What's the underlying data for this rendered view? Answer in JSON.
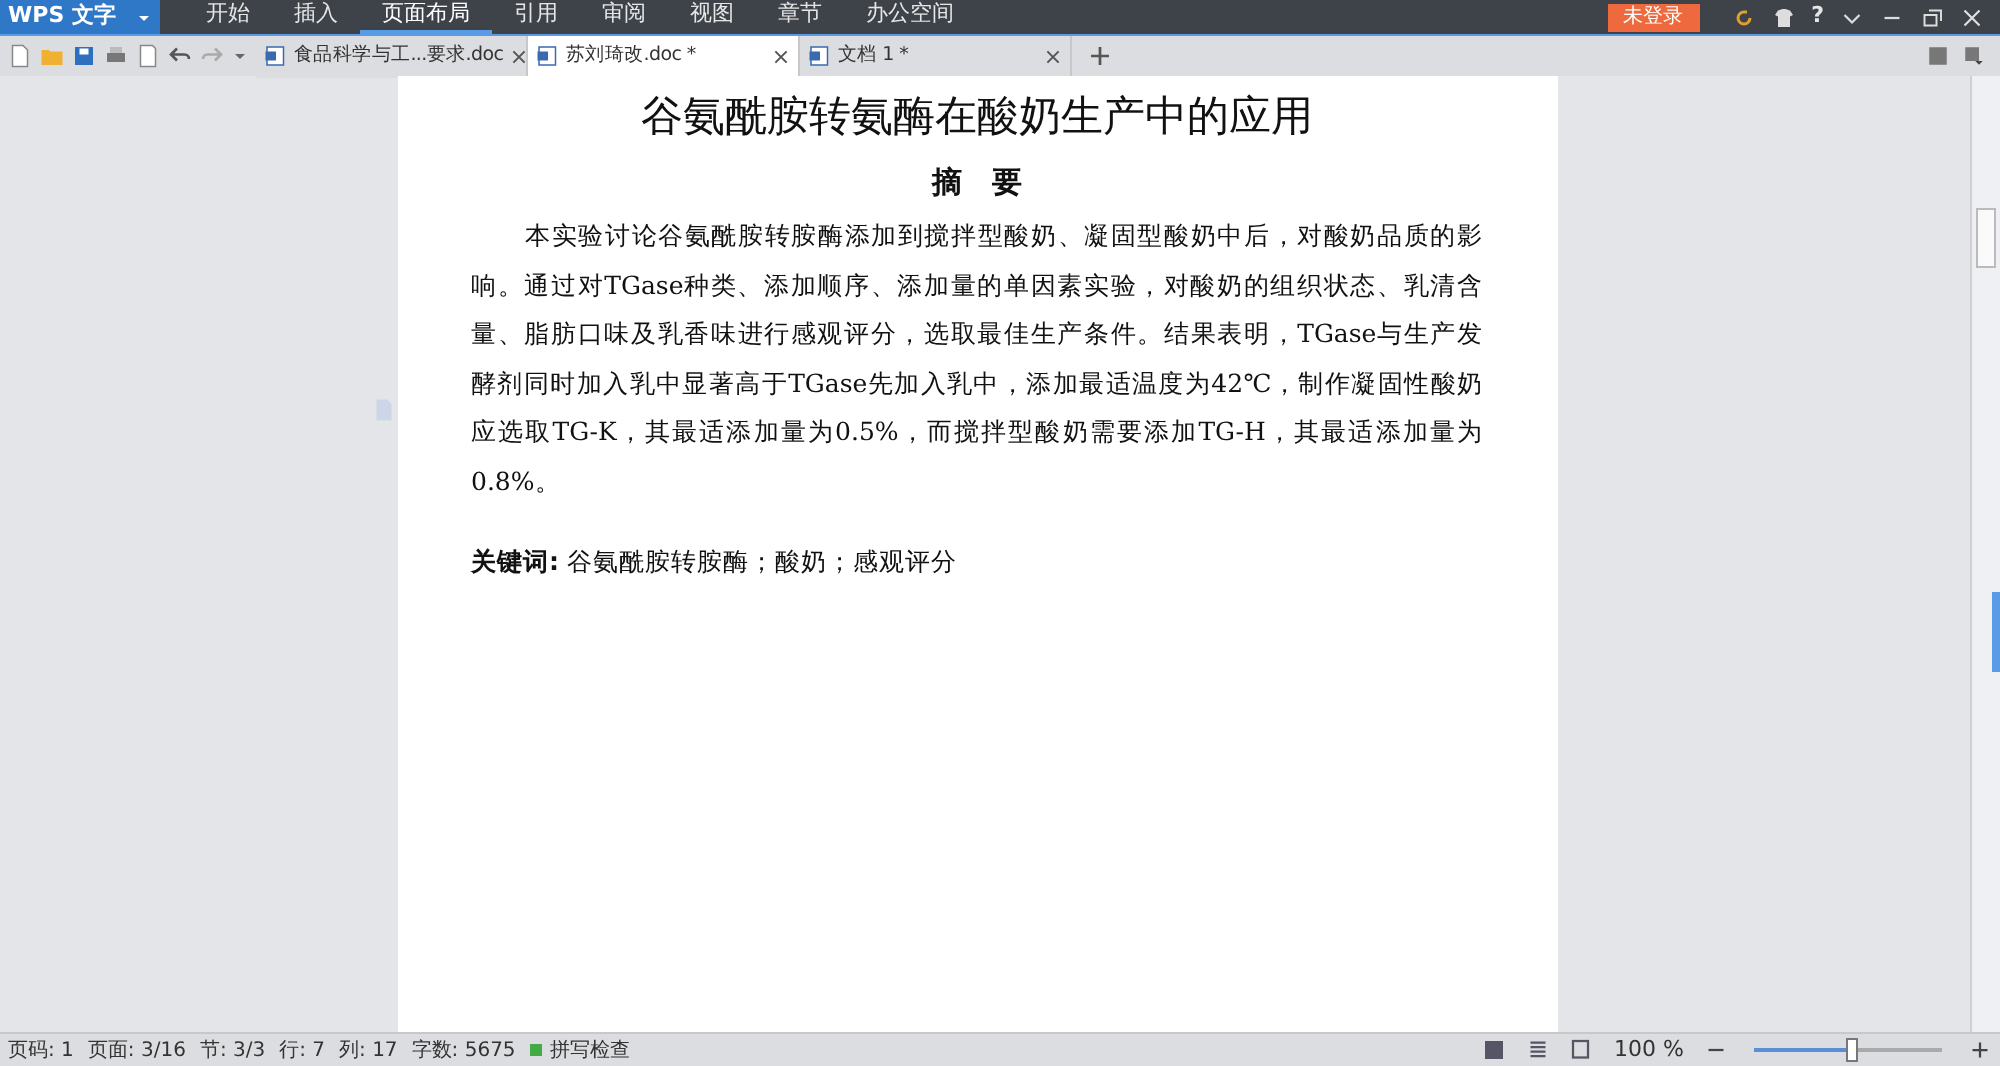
{
  "app_menu": {
    "label": "WPS 文字"
  },
  "menu": [
    {
      "label": "开始",
      "selected": false
    },
    {
      "label": "插入",
      "selected": false
    },
    {
      "label": "页面布局",
      "selected": true
    },
    {
      "label": "引用",
      "selected": false
    },
    {
      "label": "审阅",
      "selected": false
    },
    {
      "label": "视图",
      "selected": false
    },
    {
      "label": "章节",
      "selected": false
    },
    {
      "label": "办公空间",
      "selected": false
    }
  ],
  "login_button": "未登录",
  "help_label": "?",
  "tabs": [
    {
      "label": "食品科学与工...要求.doc",
      "selected": false
    },
    {
      "label": "苏刘琦改.doc *",
      "selected": true
    },
    {
      "label": "文档 1 *",
      "selected": false
    }
  ],
  "document": {
    "title": "谷氨酰胺转氨酶在酸奶生产中的应用",
    "heading": "摘　要",
    "abstract": "本实验讨论谷氨酰胺转胺酶添加到搅拌型酸奶、凝固型酸奶中后，对酸奶品质的影响。通过对TGase种类、添加顺序、添加量的单因素实验，对酸奶的组织状态、乳清含量、脂肪口味及乳香味进行感观评分，选取最佳生产条件。结果表明，TGase与生产发酵剂同时加入乳中显著高于TGase先加入乳中，添加最适温度为42℃，制作凝固性酸奶应选取TG-K，其最适添加量为0.5%，而搅拌型酸奶需要添加TG-H，其最适添加量为0.8%。",
    "keywords_label": "关键词:",
    "keywords": "谷氨酰胺转胺酶；酸奶；感观评分"
  },
  "status_bar": {
    "items": [
      "页码: 1",
      "页面: 3/16",
      "节: 3/3",
      "行: 7",
      "列: 17",
      "字数: 5675"
    ],
    "spell_check": {
      "label": "拼写检查",
      "on": true
    },
    "zoom_label": "100 %",
    "zoom": {
      "level": 0.52
    }
  }
}
